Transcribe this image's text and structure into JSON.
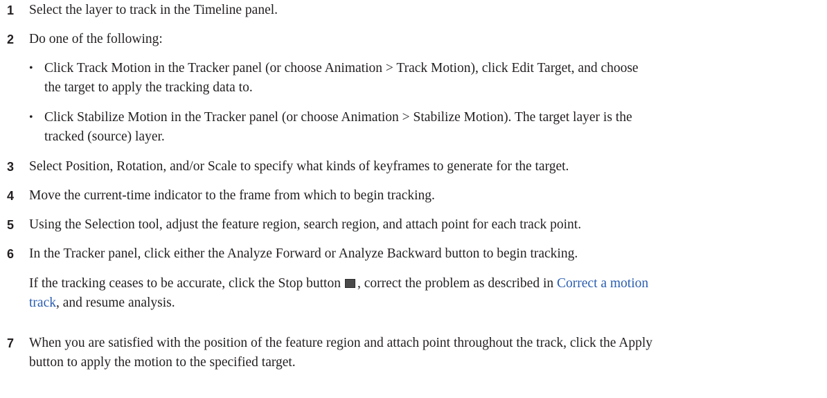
{
  "steps": [
    {
      "num": "1",
      "text": "Select the layer to track in the Timeline panel."
    },
    {
      "num": "2",
      "text": "Do one of the following:"
    },
    {
      "num": "3",
      "text": "Select Position, Rotation, and/or Scale to specify what kinds of keyframes to generate for the target."
    },
    {
      "num": "4",
      "text": "Move the current-time indicator to the frame from which to begin tracking."
    },
    {
      "num": "5",
      "text": "Using the Selection tool, adjust the feature region, search region, and attach point for each track point."
    },
    {
      "num": "6",
      "text": "In the Tracker panel, click either the Analyze Forward or Analyze Backward button to begin tracking."
    },
    {
      "num": "7",
      "line1": "When you are satisfied with the position of the feature region and attach point throughout the track, click the Apply",
      "line2": "button to apply the motion to the specified target."
    }
  ],
  "bullets": [
    {
      "mark": "•",
      "line1": "Click Track Motion in the Tracker panel (or choose Animation > Track Motion), click Edit Target, and choose",
      "line2": "the target to apply the tracking data to."
    },
    {
      "mark": "•",
      "line1": "Click Stabilize Motion in the Tracker panel (or choose Animation > Stabilize Motion). The target layer is the",
      "line2": "tracked (source) layer."
    }
  ],
  "note": {
    "before": "If the tracking ceases to be accurate, click the Stop button",
    "after": ", correct the problem as described in",
    "link_part1": "Correct a motion",
    "link_part2": "track",
    "end": ", and resume analysis."
  },
  "icons": {
    "stop": "stop-button-icon"
  }
}
